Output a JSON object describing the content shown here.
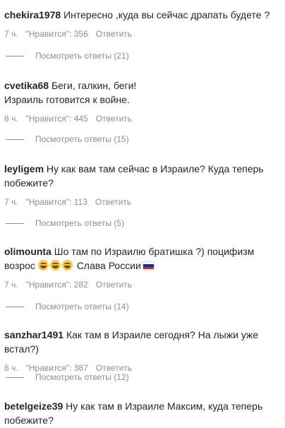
{
  "comments": [
    {
      "user": "chekira1978",
      "text": "Интересно ,куда вы сейчас драпать будете ?",
      "time": "7 ч.",
      "likes": "\"Нравится\": 356",
      "reply": "Ответить",
      "replies": "Посмотреть ответы (21)"
    },
    {
      "user": "cvetika68",
      "text": "Беги, галкин, беги!",
      "text2": "Израиль готовится к войне.",
      "time": "8 ч.",
      "likes": "\"Нравится\": 445",
      "reply": "Ответить",
      "replies": "Посмотреть ответы (15)"
    },
    {
      "user": "leyligem",
      "text": "Ну как вам там сейчас в Израиле? Куда теперь",
      "text2": "побежите?",
      "time": "7 ч.",
      "likes": "\"Нравится\": 113",
      "reply": "Ответить",
      "replies": "Посмотреть ответы (5)"
    },
    {
      "user": "olimounta",
      "text": "Шо там по Израилю братишка ?) поцифизм",
      "text2": "возрос",
      "text2_end": "Слава России",
      "time": "7 ч.",
      "likes": "\"Нравится\": 282",
      "reply": "Ответить",
      "replies": "Посмотреть ответы (14)"
    },
    {
      "user": "sanzhar1491",
      "text": "Как там в Израиле сегодня? На лыжи уже встал?)",
      "time": "8 ч.",
      "likes": "\"Нравится\": 387",
      "reply": "Ответить",
      "replies": "Посмотреть ответы (12)"
    },
    {
      "user": "betelgeize39",
      "text": "Ну как там в Израиле Максим, куда теперь",
      "text2": "побежите?"
    }
  ],
  "icons": {
    "emoji": "grinning-sweat-emoji",
    "flag": "russia-flag-icon"
  },
  "colors": {
    "text": "#262626",
    "meta": "#8e8e8e",
    "flag_white": "#ffffff",
    "flag_blue": "#0039a6",
    "flag_red": "#d52b1e"
  }
}
